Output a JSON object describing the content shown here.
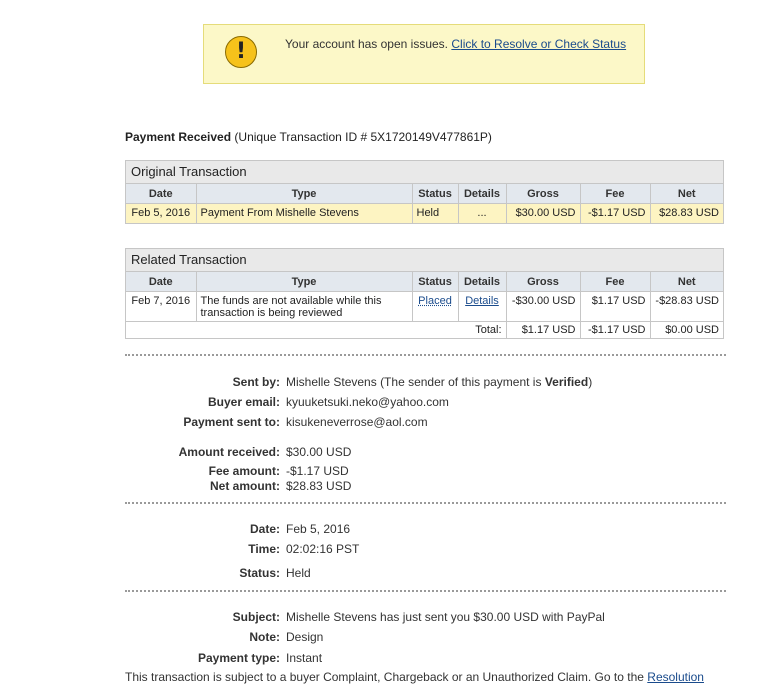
{
  "alert": {
    "icon": "exclamation-icon",
    "text": "Your account has open issues.",
    "link": "Click to Resolve or Check Status"
  },
  "payment": {
    "heading_bold": "Payment Received",
    "heading_rest": "(Unique Transaction ID # 5X1720149V477861P)"
  },
  "columns": [
    "Date",
    "Type",
    "Status",
    "Details",
    "Gross",
    "Fee",
    "Net"
  ],
  "original": {
    "title": "Original Transaction",
    "row": {
      "date": "Feb 5, 2016",
      "type": "Payment From Mishelle Stevens",
      "status": "Held",
      "details": "...",
      "gross": "$30.00 USD",
      "fee": "-$1.17 USD",
      "net": "$28.83 USD"
    }
  },
  "related": {
    "title": "Related Transaction",
    "row": {
      "date": "Feb 7, 2016",
      "type": "The funds are not available while this transaction is being reviewed",
      "status": "Placed",
      "details": "Details",
      "gross": "-$30.00 USD",
      "fee": "$1.17 USD",
      "net": "-$28.83 USD"
    },
    "total": {
      "label": "Total:",
      "gross": "$1.17 USD",
      "fee": "-$1.17 USD",
      "net": "$0.00 USD"
    }
  },
  "details": {
    "sent_by_label": "Sent by:",
    "sent_by_name": "Mishelle Stevens",
    "sent_by_note_pre": "(The sender of this payment is",
    "sent_by_verified": "Verified",
    "sent_by_note_post": ")",
    "buyer_email_label": "Buyer email:",
    "buyer_email": "kyuuketsuki.neko@yahoo.com",
    "payment_sent_to_label": "Payment sent to:",
    "payment_sent_to": "kisukeneverrose@aol.com",
    "amount_received_label": "Amount received:",
    "amount_received": "$30.00 USD",
    "fee_amount_label": "Fee amount:",
    "fee_amount": "-$1.17 USD",
    "net_amount_label": "Net amount:",
    "net_amount": "$28.83 USD",
    "date_label": "Date:",
    "date": "Feb 5, 2016",
    "time_label": "Time:",
    "time": "02:02:16 PST",
    "status_label": "Status:",
    "status": "Held",
    "subject_label": "Subject:",
    "subject": "Mishelle Stevens has just sent you $30.00 USD with PayPal",
    "note_label": "Note:",
    "note": "Design",
    "payment_type_label": "Payment type:",
    "payment_type": "Instant"
  },
  "footer": {
    "text": "This transaction is subject to a buyer Complaint, Chargeback or an Unauthorized Claim. Go to the",
    "link": "Resolution"
  }
}
